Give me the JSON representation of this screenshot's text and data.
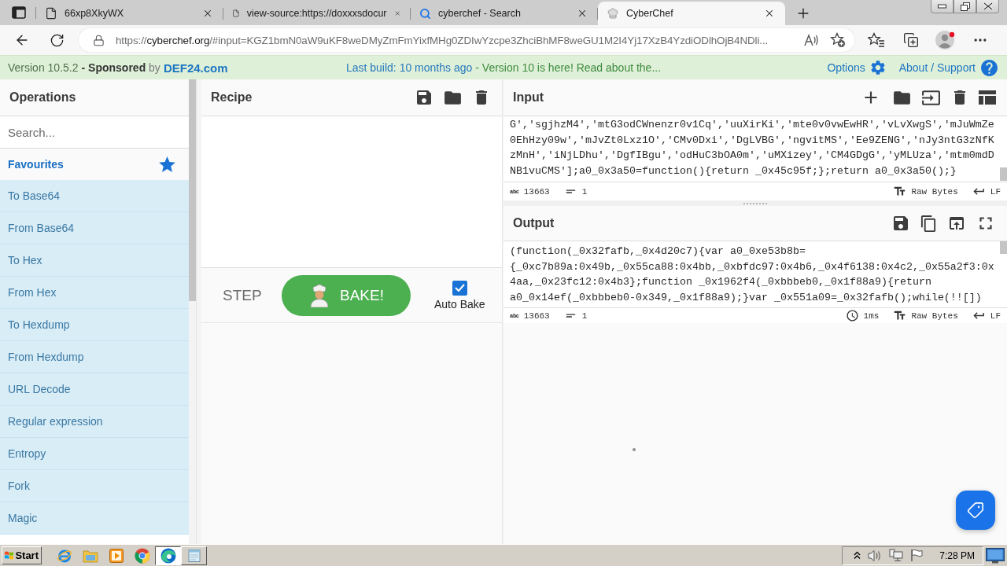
{
  "browser": {
    "tabs": [
      {
        "kind": "page",
        "title": "66xp8XkyWX",
        "selected": false
      },
      {
        "kind": "page",
        "title": "view-source:https://doxxxsdocur",
        "selected": false
      },
      {
        "kind": "search",
        "title": "cyberchef - Search",
        "selected": false
      },
      {
        "kind": "app",
        "title": "CyberChef",
        "selected": true
      }
    ],
    "address": {
      "scheme": "https://",
      "host": "cyberchef.org",
      "rest": "/#input=KGZ1bmN0aW9uKF8weDMyZmFmYixfMHg0ZDIwYzcpe3ZhciBhMF8weGU1M2I4Yj17XzB4YzdiODlhOjB4NDli..."
    }
  },
  "banner": {
    "version": "Version 10.5.2",
    "sponsor": "**- Sponsored** by",
    "sponsor_link": "DEF24.com",
    "build": "Last build: 10 months ago",
    "notice": "- Version 10 is here! Read about the...",
    "options": "Options",
    "about": "About / Support"
  },
  "operations": {
    "title": "Operations",
    "search": {
      "placeholder": "Search..."
    },
    "favourites": "Favourites",
    "items": [
      "To Base64",
      "From Base64",
      "To Hex",
      "From Hex",
      "To Hexdump",
      "From Hexdump",
      "URL Decode",
      "Regular expression",
      "Entropy",
      "Fork",
      "Magic"
    ]
  },
  "recipe": {
    "title": "Recipe",
    "step": "STEP",
    "bake": "BAKE!",
    "auto_bake": {
      "label": "Auto Bake",
      "checked": true
    }
  },
  "input": {
    "title": "Input",
    "lines": [
      "G','sgjhzM4','mtG3odCWnenzr0v1Cq','uuXirKi','mte0v0vwEwHR','vLvXwgS','mJuWmZe",
      "0EhHzy09w','mJvZt0Lxz1O','CMv0Dxi','DgLVBG','ngvitMS','Ee9ZENG','nJy3ntG3zNfK",
      "zMnH','iNjLDhu','DgfIBgu','odHuC3bOA0m','uMXizey','CM4GDgG','yMLUza','mtm0mdD",
      "NB1vuCMS'];a0_0x3a50=function(){return _0x45c95f;};return a0_0x3a50();}"
    ],
    "status": [
      {
        "kind": "length",
        "icon_text": "abc",
        "value": "13663"
      },
      {
        "kind": "lines",
        "value": "1"
      },
      {
        "kind": "encoding",
        "value": "Raw Bytes"
      },
      {
        "kind": "eol",
        "value": "LF"
      }
    ]
  },
  "output": {
    "title": "Output",
    "lines": [
      "(function(_0x32fafb,_0x4d20c7){var a0_0xe53b8b=",
      "{_0xc7b89a:0x49b,_0x55ca88:0x4bb,_0xbfdc97:0x4b6,_0x4f6138:0x4c2,_0x55a2f3:0x",
      "4aa,_0x23fc12:0x4b3};function _0x1962f4(_0xbbbeb0,_0x1f88a9){return",
      "a0_0x14ef(_0xbbbeb0-0x349,_0x1f88a9);}var _0x551a09=_0x32fafb();while(!![])"
    ],
    "status": [
      {
        "kind": "length",
        "icon_text": "abc",
        "value": "13663"
      },
      {
        "kind": "lines",
        "value": "1"
      },
      {
        "kind": "time",
        "value": "1ms"
      },
      {
        "kind": "encoding",
        "value": "Raw Bytes"
      },
      {
        "kind": "eol",
        "value": "LF"
      }
    ]
  },
  "taskbar": {
    "start": "Start",
    "tasks": [
      {
        "selected": true
      },
      {
        "selected": false
      }
    ],
    "clock": "7:28 PM"
  }
}
